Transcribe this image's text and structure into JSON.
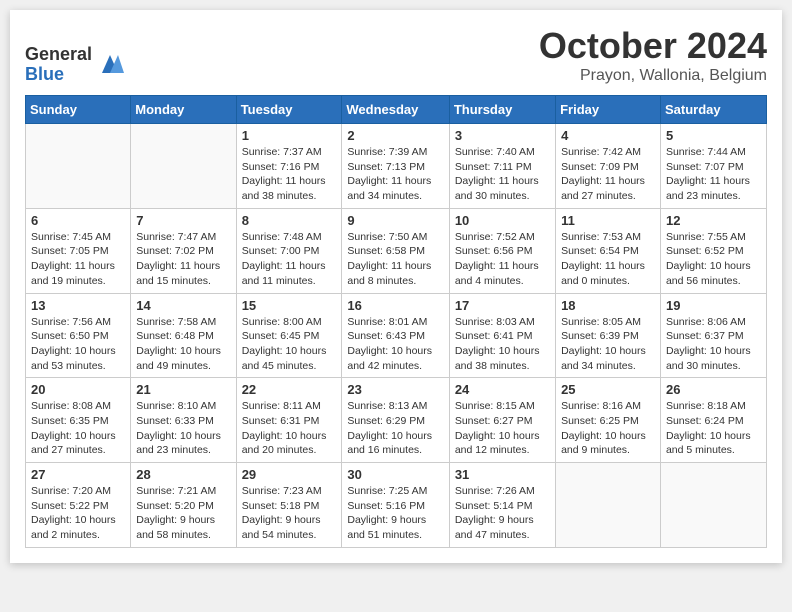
{
  "header": {
    "logo_general": "General",
    "logo_blue": "Blue",
    "month_title": "October 2024",
    "location": "Prayon, Wallonia, Belgium"
  },
  "weekdays": [
    "Sunday",
    "Monday",
    "Tuesday",
    "Wednesday",
    "Thursday",
    "Friday",
    "Saturday"
  ],
  "weeks": [
    [
      {
        "day": "",
        "info": ""
      },
      {
        "day": "",
        "info": ""
      },
      {
        "day": "1",
        "info": "Sunrise: 7:37 AM\nSunset: 7:16 PM\nDaylight: 11 hours and 38 minutes."
      },
      {
        "day": "2",
        "info": "Sunrise: 7:39 AM\nSunset: 7:13 PM\nDaylight: 11 hours and 34 minutes."
      },
      {
        "day": "3",
        "info": "Sunrise: 7:40 AM\nSunset: 7:11 PM\nDaylight: 11 hours and 30 minutes."
      },
      {
        "day": "4",
        "info": "Sunrise: 7:42 AM\nSunset: 7:09 PM\nDaylight: 11 hours and 27 minutes."
      },
      {
        "day": "5",
        "info": "Sunrise: 7:44 AM\nSunset: 7:07 PM\nDaylight: 11 hours and 23 minutes."
      }
    ],
    [
      {
        "day": "6",
        "info": "Sunrise: 7:45 AM\nSunset: 7:05 PM\nDaylight: 11 hours and 19 minutes."
      },
      {
        "day": "7",
        "info": "Sunrise: 7:47 AM\nSunset: 7:02 PM\nDaylight: 11 hours and 15 minutes."
      },
      {
        "day": "8",
        "info": "Sunrise: 7:48 AM\nSunset: 7:00 PM\nDaylight: 11 hours and 11 minutes."
      },
      {
        "day": "9",
        "info": "Sunrise: 7:50 AM\nSunset: 6:58 PM\nDaylight: 11 hours and 8 minutes."
      },
      {
        "day": "10",
        "info": "Sunrise: 7:52 AM\nSunset: 6:56 PM\nDaylight: 11 hours and 4 minutes."
      },
      {
        "day": "11",
        "info": "Sunrise: 7:53 AM\nSunset: 6:54 PM\nDaylight: 11 hours and 0 minutes."
      },
      {
        "day": "12",
        "info": "Sunrise: 7:55 AM\nSunset: 6:52 PM\nDaylight: 10 hours and 56 minutes."
      }
    ],
    [
      {
        "day": "13",
        "info": "Sunrise: 7:56 AM\nSunset: 6:50 PM\nDaylight: 10 hours and 53 minutes."
      },
      {
        "day": "14",
        "info": "Sunrise: 7:58 AM\nSunset: 6:48 PM\nDaylight: 10 hours and 49 minutes."
      },
      {
        "day": "15",
        "info": "Sunrise: 8:00 AM\nSunset: 6:45 PM\nDaylight: 10 hours and 45 minutes."
      },
      {
        "day": "16",
        "info": "Sunrise: 8:01 AM\nSunset: 6:43 PM\nDaylight: 10 hours and 42 minutes."
      },
      {
        "day": "17",
        "info": "Sunrise: 8:03 AM\nSunset: 6:41 PM\nDaylight: 10 hours and 38 minutes."
      },
      {
        "day": "18",
        "info": "Sunrise: 8:05 AM\nSunset: 6:39 PM\nDaylight: 10 hours and 34 minutes."
      },
      {
        "day": "19",
        "info": "Sunrise: 8:06 AM\nSunset: 6:37 PM\nDaylight: 10 hours and 30 minutes."
      }
    ],
    [
      {
        "day": "20",
        "info": "Sunrise: 8:08 AM\nSunset: 6:35 PM\nDaylight: 10 hours and 27 minutes."
      },
      {
        "day": "21",
        "info": "Sunrise: 8:10 AM\nSunset: 6:33 PM\nDaylight: 10 hours and 23 minutes."
      },
      {
        "day": "22",
        "info": "Sunrise: 8:11 AM\nSunset: 6:31 PM\nDaylight: 10 hours and 20 minutes."
      },
      {
        "day": "23",
        "info": "Sunrise: 8:13 AM\nSunset: 6:29 PM\nDaylight: 10 hours and 16 minutes."
      },
      {
        "day": "24",
        "info": "Sunrise: 8:15 AM\nSunset: 6:27 PM\nDaylight: 10 hours and 12 minutes."
      },
      {
        "day": "25",
        "info": "Sunrise: 8:16 AM\nSunset: 6:25 PM\nDaylight: 10 hours and 9 minutes."
      },
      {
        "day": "26",
        "info": "Sunrise: 8:18 AM\nSunset: 6:24 PM\nDaylight: 10 hours and 5 minutes."
      }
    ],
    [
      {
        "day": "27",
        "info": "Sunrise: 7:20 AM\nSunset: 5:22 PM\nDaylight: 10 hours and 2 minutes."
      },
      {
        "day": "28",
        "info": "Sunrise: 7:21 AM\nSunset: 5:20 PM\nDaylight: 9 hours and 58 minutes."
      },
      {
        "day": "29",
        "info": "Sunrise: 7:23 AM\nSunset: 5:18 PM\nDaylight: 9 hours and 54 minutes."
      },
      {
        "day": "30",
        "info": "Sunrise: 7:25 AM\nSunset: 5:16 PM\nDaylight: 9 hours and 51 minutes."
      },
      {
        "day": "31",
        "info": "Sunrise: 7:26 AM\nSunset: 5:14 PM\nDaylight: 9 hours and 47 minutes."
      },
      {
        "day": "",
        "info": ""
      },
      {
        "day": "",
        "info": ""
      }
    ]
  ]
}
